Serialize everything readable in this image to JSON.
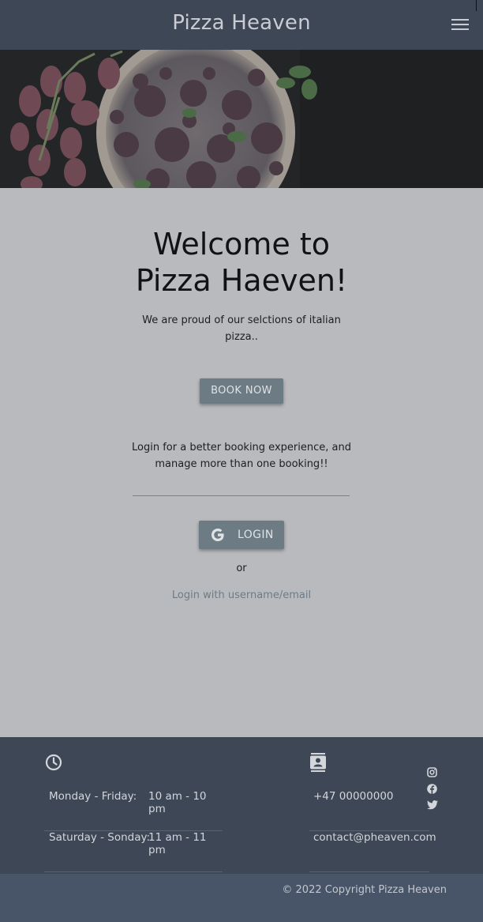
{
  "header": {
    "brand": "Pizza Heaven",
    "menu_icon": "hamburger-menu-icon"
  },
  "hero": {
    "image": "pizza-and-tomatoes-photo"
  },
  "main": {
    "title_line1": "Welcome to",
    "title_line2": "Pizza Haeven!",
    "intro": "We are proud of our selctions of italian pizza..",
    "book_label": "BOOK NOW",
    "login_prompt": "Login for a better booking experience, and manage more than one booking!!",
    "google_icon": "google-icon",
    "login_label": "LOGIN",
    "or_text": "or",
    "alt_login": "Login with username/email"
  },
  "footer": {
    "hours_icon": "clock-icon",
    "hours": [
      {
        "day": "Monday - Friday:",
        "time": "10 am - 10 pm"
      },
      {
        "day": "Saturday - Sonday:",
        "time": "11 am - 11 pm"
      }
    ],
    "contact_icon": "contact-card-icon",
    "contact": {
      "phone": "+47 00000000",
      "email": "contact@pheaven.com"
    },
    "social": [
      "instagram-icon",
      "facebook-icon",
      "twitter-icon"
    ],
    "copyright": "© 2022 Copyright Pizza Heaven"
  },
  "colors": {
    "nav": "#3e4756",
    "page": "#b9babd",
    "button": "#6c7b84",
    "link": "#6d7b86"
  }
}
